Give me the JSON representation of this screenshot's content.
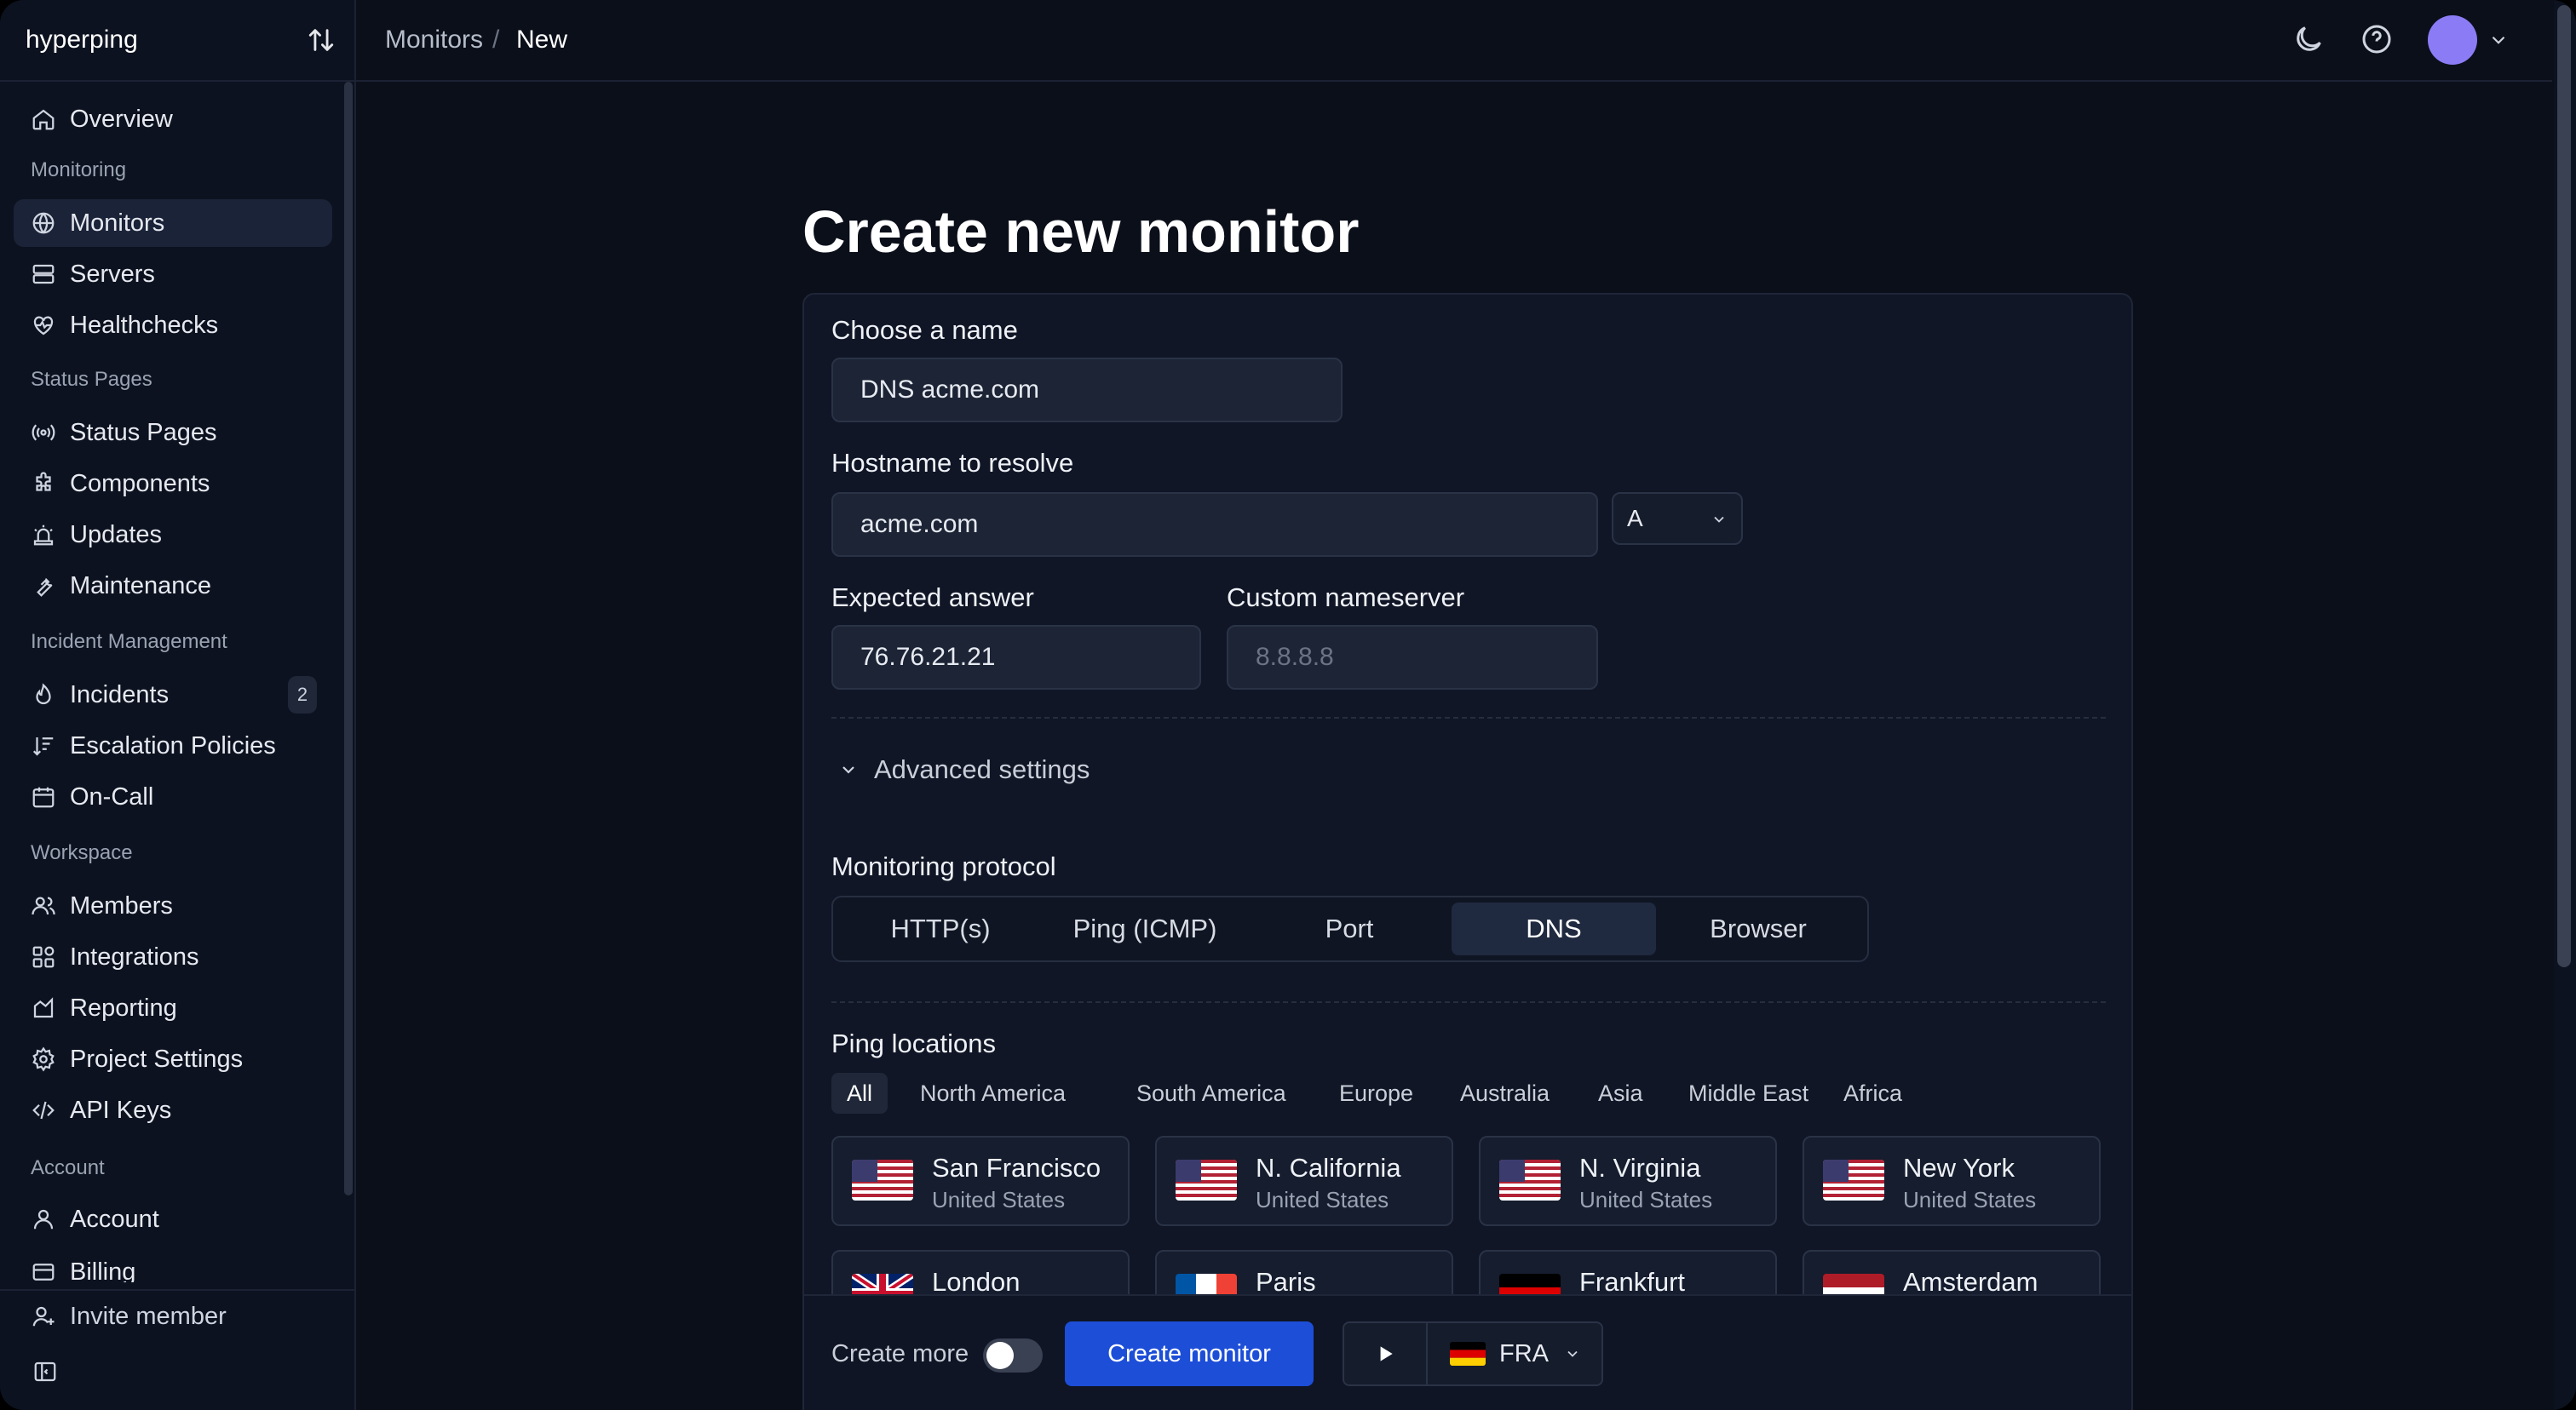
{
  "app": {
    "name": "hyperping"
  },
  "breadcrumb": {
    "parent": "Monitors",
    "separator": "/",
    "current": "New"
  },
  "sidebar": {
    "overview": "Overview",
    "section_monitoring": "Monitoring",
    "monitors": "Monitors",
    "servers": "Servers",
    "healthchecks": "Healthchecks",
    "section_status": "Status Pages",
    "status_pages": "Status Pages",
    "components": "Components",
    "updates": "Updates",
    "maintenance": "Maintenance",
    "section_incident": "Incident Management",
    "incidents": "Incidents",
    "incidents_count": "2",
    "escalation": "Escalation Policies",
    "oncall": "On-Call",
    "section_workspace": "Workspace",
    "members": "Members",
    "integrations": "Integrations",
    "reporting": "Reporting",
    "project_settings": "Project Settings",
    "api_keys": "API Keys",
    "section_account": "Account",
    "account": "Account",
    "billing": "Billing",
    "invite": "Invite member"
  },
  "form": {
    "title": "Create new monitor",
    "name_label": "Choose a name",
    "name_value": "DNS acme.com",
    "hostname_label": "Hostname to resolve",
    "hostname_value": "acme.com",
    "record_type": "A",
    "expected_label": "Expected answer",
    "expected_value": "76.76.21.21",
    "nameserver_label": "Custom nameserver",
    "nameserver_placeholder": "8.8.8.8",
    "advanced": "Advanced settings",
    "protocol_label": "Monitoring protocol",
    "protocols": [
      "HTTP(s)",
      "Ping (ICMP)",
      "Port",
      "DNS",
      "Browser"
    ],
    "protocol_selected": "DNS",
    "locations_label": "Ping locations",
    "regions": [
      "All",
      "North America",
      "South America",
      "Europe",
      "Australia",
      "Asia",
      "Middle East",
      "Africa"
    ],
    "region_selected": "All",
    "locations": [
      {
        "city": "San Francisco",
        "country": "United States",
        "flag": "us"
      },
      {
        "city": "N. California",
        "country": "United States",
        "flag": "us"
      },
      {
        "city": "N. Virginia",
        "country": "United States",
        "flag": "us"
      },
      {
        "city": "New York",
        "country": "United States",
        "flag": "us"
      },
      {
        "city": "London",
        "country": "",
        "flag": "uk"
      },
      {
        "city": "Paris",
        "country": "",
        "flag": "fr"
      },
      {
        "city": "Frankfurt",
        "country": "",
        "flag": "de"
      },
      {
        "city": "Amsterdam",
        "country": "",
        "flag": "nl"
      }
    ]
  },
  "footer": {
    "create_more": "Create more",
    "create_more_enabled": false,
    "create_button": "Create monitor",
    "region_code": "FRA"
  },
  "colors": {
    "accent": "#1d4ed8",
    "avatar": "#8b7cf6",
    "background": "#0b0f1a"
  }
}
